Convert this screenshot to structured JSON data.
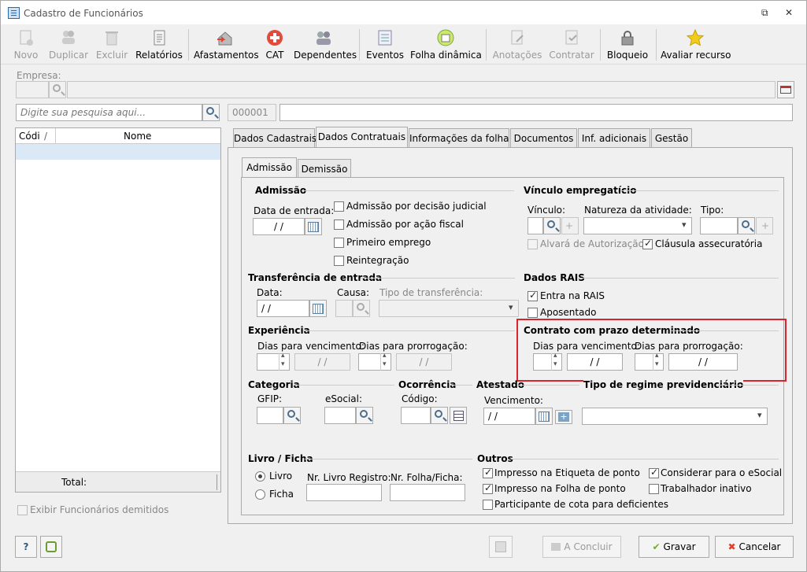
{
  "window": {
    "title": "Cadastro de Funcionários",
    "restore_glyph": "⧉",
    "close_glyph": "✕"
  },
  "toolbar": [
    {
      "id": "novo",
      "label": "Novo",
      "icon": "new-document-icon",
      "enabled": false
    },
    {
      "id": "duplicar",
      "label": "Duplicar",
      "icon": "duplicate-users-icon",
      "enabled": false
    },
    {
      "id": "excluir",
      "label": "Excluir",
      "icon": "trash-icon",
      "enabled": false
    },
    {
      "id": "relatorios",
      "label": "Relatórios",
      "icon": "report-icon",
      "enabled": true
    },
    {
      "id": "afastamentos",
      "label": "Afastamentos",
      "icon": "house-arrow-icon",
      "enabled": true
    },
    {
      "id": "cat",
      "label": "CAT",
      "icon": "red-cross-icon",
      "enabled": true
    },
    {
      "id": "dependentes",
      "label": "Dependentes",
      "icon": "users-icon",
      "enabled": true
    },
    {
      "id": "eventos",
      "label": "Eventos",
      "icon": "list-icon",
      "enabled": true
    },
    {
      "id": "folha",
      "label": "Folha dinâmica",
      "icon": "calendar-refresh-icon",
      "enabled": true
    },
    {
      "id": "anotacoes",
      "label": "Anotações",
      "icon": "annotation-icon",
      "enabled": false
    },
    {
      "id": "contratar",
      "label": "Contratar",
      "icon": "contract-icon",
      "enabled": false
    },
    {
      "id": "bloqueio",
      "label": "Bloqueio",
      "icon": "lock-icon",
      "enabled": true
    },
    {
      "id": "avaliar",
      "label": "Avaliar recurso",
      "icon": "star-icon",
      "enabled": true
    }
  ],
  "empresa": {
    "label": "Empresa:"
  },
  "search": {
    "placeholder": "Digite sua pesquisa aqui..."
  },
  "code_field": {
    "value": "000001"
  },
  "list": {
    "col_code": "Códi",
    "col_sort": "/",
    "col_name": "Nome",
    "total_label": "Total:"
  },
  "show_dismissed": "Exibir Funcionários demitidos",
  "tabs": [
    "Dados Cadastrais",
    "Dados Contratuais",
    "Informações da folha",
    "Documentos",
    "Inf. adicionais",
    "Gestão"
  ],
  "subtabs": [
    "Admissão",
    "Demissão"
  ],
  "admissao": {
    "title": "Admissão",
    "data_entrada": "Data de entrada:",
    "date_val": "/  /",
    "cb": [
      "Admissão por decisão judicial",
      "Admissão por ação fiscal",
      "Primeiro emprego",
      "Reintegração"
    ]
  },
  "vinculo": {
    "title": "Vínculo empregatício",
    "vinculo": "Vínculo:",
    "natureza": "Natureza da atividade:",
    "tipo": "Tipo:",
    "alvara": "Alvará de Autorização",
    "clausula": "Cláusula assecuratória"
  },
  "transf": {
    "title": "Transferência de entrada",
    "data": "Data:",
    "causa": "Causa:",
    "tipo": "Tipo de transferência:",
    "date_val": "/ /"
  },
  "rais": {
    "title": "Dados RAIS",
    "entra": "Entra na RAIS",
    "aposentado": "Aposentado"
  },
  "experiencia": {
    "title": "Experiência",
    "dias_venc": "Dias para vencimento:",
    "dias_prorr": "Dias para prorrogação:",
    "date_val": "/  /"
  },
  "contrato": {
    "title": "Contrato com prazo determinado",
    "dias_venc": "Dias para vencimento:",
    "dias_prorr": "Dias para prorrogação:",
    "date_val": "/  /"
  },
  "categoria": {
    "title": "Categoria",
    "gfip": "GFIP:",
    "esocial": "eSocial:"
  },
  "ocorrencia": {
    "title": "Ocorrência",
    "codigo": "Código:"
  },
  "atestado": {
    "title": "Atestado",
    "venc": "Vencimento:",
    "date_val": "/  /"
  },
  "regime": {
    "title": "Tipo de regime previdenciário"
  },
  "livro": {
    "title": "Livro / Ficha",
    "livro": "Livro",
    "ficha": "Ficha",
    "nr_livro": "Nr. Livro Registro:",
    "nr_folha": "Nr. Folha/Ficha:"
  },
  "outros": {
    "title": "Outros",
    "cb": [
      "Impresso na Etiqueta de ponto",
      "Impresso na Folha de ponto",
      "Participante de cota para deficientes",
      "Considerar para o eSocial",
      "Trabalhador inativo"
    ]
  },
  "footer": {
    "help": "?",
    "concluir": "A Concluir",
    "gravar": "Gravar",
    "cancelar": "Cancelar"
  },
  "colors": {
    "highlight": "#d9232d",
    "selected_row": "#dbe9f7"
  }
}
